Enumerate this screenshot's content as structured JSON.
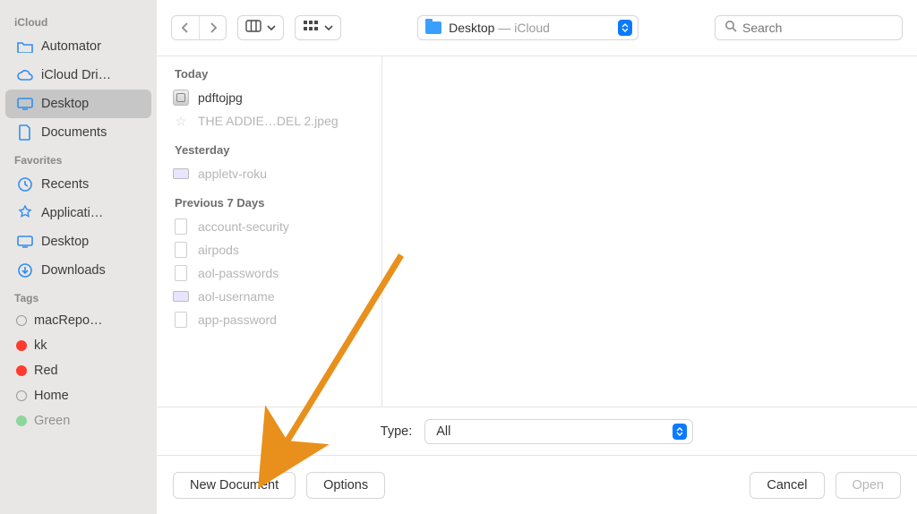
{
  "sidebar": {
    "sections": [
      {
        "header": "iCloud",
        "items": [
          {
            "label": "Automator",
            "icon": "folder-icon",
            "selected": false
          },
          {
            "label": "iCloud Dri…",
            "icon": "cloud-icon",
            "selected": false
          },
          {
            "label": "Desktop",
            "icon": "desktop-icon",
            "selected": true
          },
          {
            "label": "Documents",
            "icon": "document-icon",
            "selected": false
          }
        ]
      },
      {
        "header": "Favorites",
        "items": [
          {
            "label": "Recents",
            "icon": "clock-icon",
            "selected": false
          },
          {
            "label": "Applicati…",
            "icon": "app-icon",
            "selected": false
          },
          {
            "label": "Desktop",
            "icon": "desktop-icon",
            "selected": false
          },
          {
            "label": "Downloads",
            "icon": "download-icon",
            "selected": false
          }
        ]
      },
      {
        "header": "Tags",
        "items": [
          {
            "label": "macRepo…",
            "icon": "tag-dot",
            "selected": false
          },
          {
            "label": "kk",
            "icon": "tag-dot-red",
            "selected": false
          },
          {
            "label": "Red",
            "icon": "tag-dot-red",
            "selected": false
          },
          {
            "label": "Home",
            "icon": "tag-dot",
            "selected": false
          },
          {
            "label": "Green",
            "icon": "tag-dot-green",
            "selected": false
          }
        ]
      }
    ]
  },
  "toolbar": {
    "path_folder": "Desktop",
    "path_suffix": " — iCloud",
    "search_placeholder": "Search"
  },
  "filelist": {
    "groups": [
      {
        "header": "Today",
        "rows": [
          {
            "name": "pdftojpg",
            "icon": "automator-file-icon",
            "dimmed": false
          },
          {
            "name": "THE ADDIE…DEL 2.jpeg",
            "icon": "star-icon",
            "dimmed": true
          }
        ]
      },
      {
        "header": "Yesterday",
        "rows": [
          {
            "name": "appletv-roku",
            "icon": "tv-file-icon",
            "dimmed": true
          }
        ]
      },
      {
        "header": "Previous 7 Days",
        "rows": [
          {
            "name": "account-security",
            "icon": "page-icon",
            "dimmed": true
          },
          {
            "name": "airpods",
            "icon": "page-icon",
            "dimmed": true
          },
          {
            "name": "aol-passwords",
            "icon": "page-icon",
            "dimmed": true
          },
          {
            "name": "aol-username",
            "icon": "tv-file-icon",
            "dimmed": true
          },
          {
            "name": "app-password",
            "icon": "page-icon",
            "dimmed": true
          }
        ]
      }
    ]
  },
  "type_row": {
    "label": "Type:",
    "value": "All"
  },
  "footer": {
    "new_document": "New Document",
    "options": "Options",
    "cancel": "Cancel",
    "open": "Open"
  },
  "annotation": {
    "arrow_color": "#e8901b"
  }
}
